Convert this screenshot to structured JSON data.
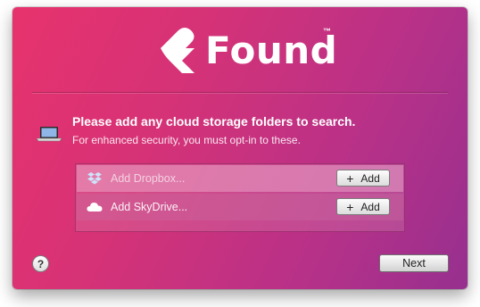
{
  "app": {
    "logo_text": "Found",
    "trademark": "™"
  },
  "prompt": {
    "heading": "Please add any cloud storage folders to search.",
    "subheading": "For enhanced security, you must opt-in to these."
  },
  "services": [
    {
      "icon": "dropbox-icon",
      "label": "Add Dropbox...",
      "button": "Add",
      "state": "disabled-label"
    },
    {
      "icon": "skydrive-cloud-icon",
      "label": "Add SkyDrive...",
      "button": "Add",
      "state": "normal"
    }
  ],
  "footer": {
    "help_label": "?",
    "next_label": "Next"
  },
  "colors": {
    "gradient_start": "#e7336d",
    "gradient_end": "#97308f",
    "text": "#ffffff"
  }
}
